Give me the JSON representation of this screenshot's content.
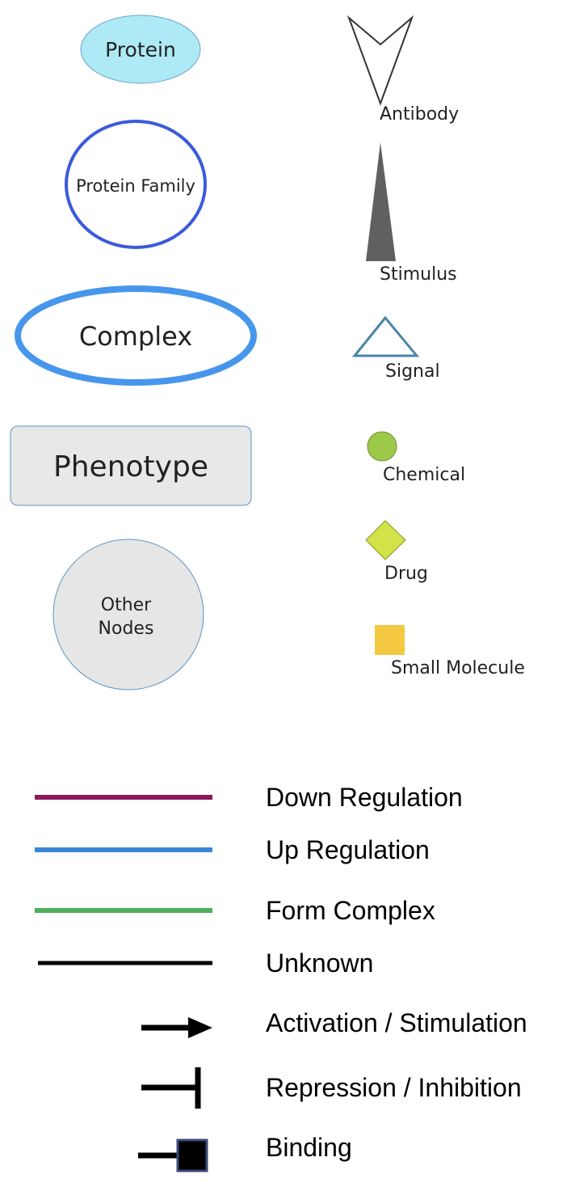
{
  "node_legend": {
    "protein": {
      "label": "Protein",
      "fill": "#aeeaf5",
      "stroke": "#6aa3c8"
    },
    "protein_family": {
      "label": "Protein Family",
      "stroke": "#3b5bdb"
    },
    "complex": {
      "label": "Complex",
      "stroke": "#4796ec"
    },
    "phenotype": {
      "label": "Phenotype",
      "fill": "#e8e8e8",
      "stroke": "#5b94c9"
    },
    "other_nodes": {
      "label_line1": "Other",
      "label_line2": "Nodes",
      "fill": "#e6e6e6",
      "stroke": "#5b94c9"
    },
    "antibody": {
      "label": "Antibody",
      "stroke": "#333333"
    },
    "stimulus": {
      "label": "Stimulus",
      "fill": "#606060"
    },
    "signal": {
      "label": "Signal",
      "stroke": "#4a86a8"
    },
    "chemical": {
      "label": "Chemical",
      "fill": "#9dc94a"
    },
    "drug": {
      "label": "Drug",
      "fill": "#d4e24a"
    },
    "small_molecule": {
      "label": "Small Molecule",
      "fill": "#f5c842"
    }
  },
  "edge_legend": {
    "down_regulation": {
      "label": "Down Regulation",
      "color": "#8b1a5c"
    },
    "up_regulation": {
      "label": "Up Regulation",
      "color": "#3b86d8"
    },
    "form_complex": {
      "label": "Form Complex",
      "color": "#4daf5c"
    },
    "unknown": {
      "label": "Unknown",
      "color": "#000000"
    },
    "activation": {
      "label": "Activation / Stimulation",
      "color": "#000000"
    },
    "repression": {
      "label": "Repression / Inhibition",
      "color": "#000000"
    },
    "binding": {
      "label": "Binding",
      "color": "#000000",
      "outline": "#3a4a7a"
    }
  }
}
